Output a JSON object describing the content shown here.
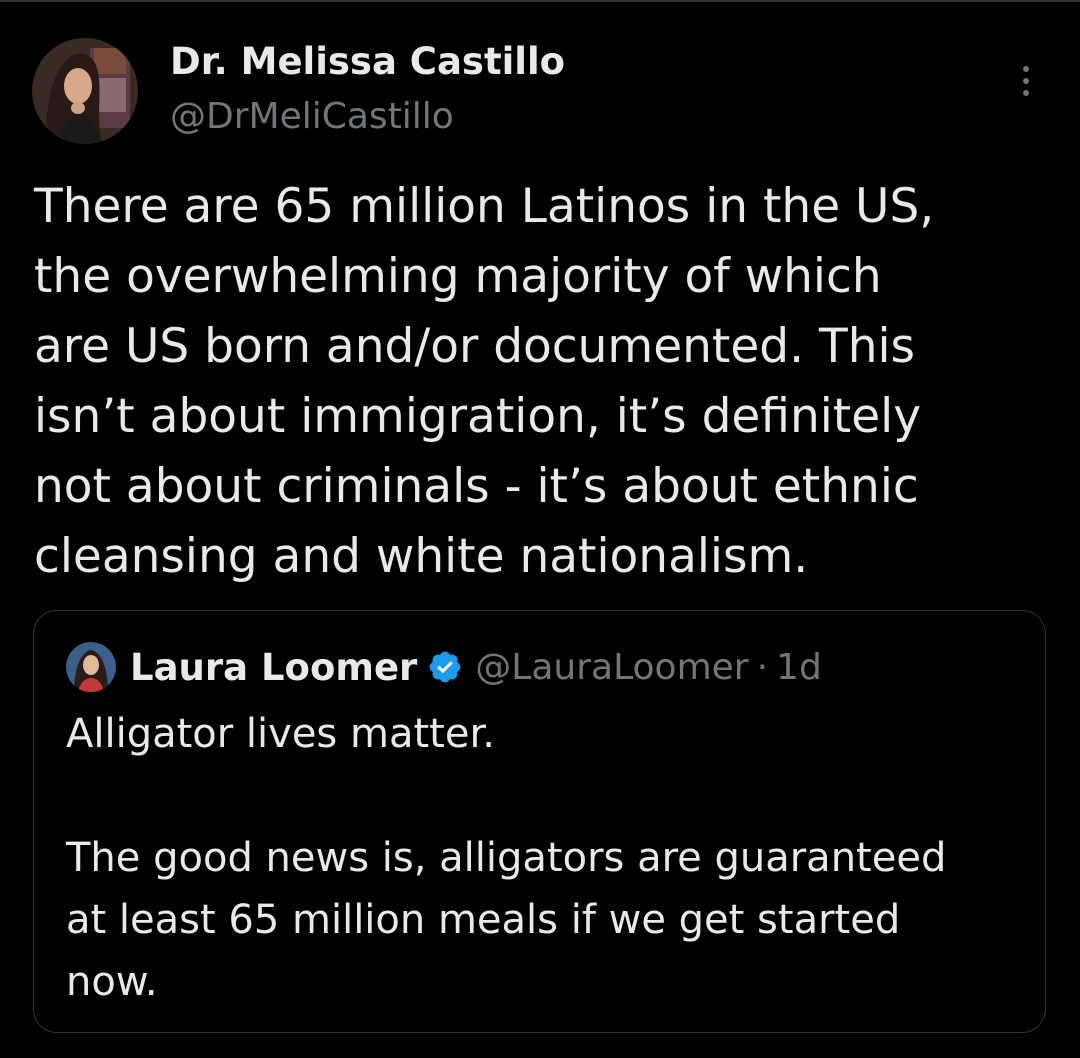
{
  "tweet": {
    "author_name": "Dr. Melissa Castillo",
    "author_handle": "@DrMeliCastillo",
    "avatar_icon": "profile-photo",
    "more_icon": "more-options-icon",
    "text_lines": [
      "There are 65 million Latinos in the US,",
      "the overwhelming majority of which",
      "are US born and/or documented. This",
      "isn’t about immigration, it’s definitely",
      "not about criminals - it’s about ethnic",
      "cleansing and white nationalism."
    ]
  },
  "quote": {
    "author_name": "Laura Loomer",
    "author_handle": "@LauraLoomer",
    "separator": "·",
    "time": "1d",
    "verified_icon": "verified-badge-icon",
    "verified_color": "#1d9bf0",
    "text_paragraph_1": [
      "Alligator lives matter."
    ],
    "text_paragraph_2": [
      "The good news is, alligators are guaranteed",
      "at least 65 million meals if we get started",
      "now."
    ]
  },
  "colors": {
    "background": "#000000",
    "primary_text": "#e7e9ea",
    "secondary_text": "#71767b",
    "border": "#2f3336"
  }
}
